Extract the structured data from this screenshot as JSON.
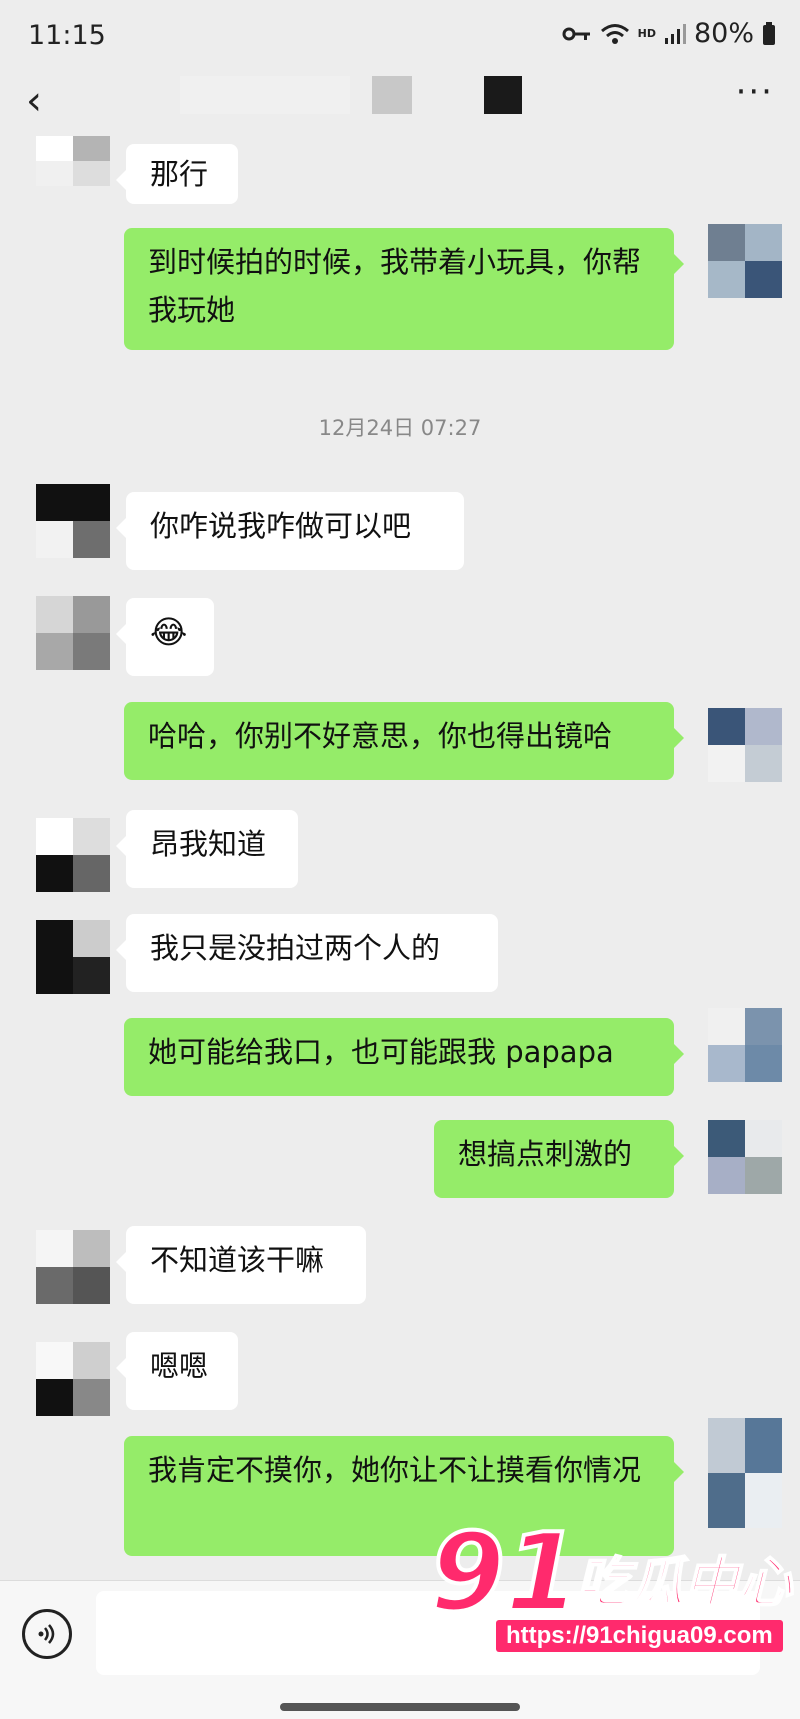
{
  "status_bar": {
    "time": "11:15",
    "battery": "80%",
    "network_label": "HD"
  },
  "header": {
    "back_icon": "‹",
    "more_icon": "···"
  },
  "timestamp": "12月24日 07:27",
  "messages": [
    {
      "side": "left",
      "text": "那行"
    },
    {
      "side": "right",
      "text": "到时候拍的时候，我带着小玩具，你帮我玩她"
    },
    {
      "side": "left",
      "text": "你咋说我咋做可以吧"
    },
    {
      "side": "left",
      "text": "😂",
      "icon": "laughing-tears-emoji"
    },
    {
      "side": "right",
      "text": "哈哈，你别不好意思，你也得出镜哈"
    },
    {
      "side": "left",
      "text": "昂我知道"
    },
    {
      "side": "left",
      "text": "我只是没拍过两个人的"
    },
    {
      "side": "right",
      "text": "她可能给我口，也可能跟我 papapa"
    },
    {
      "side": "right",
      "text": "想搞点刺激的"
    },
    {
      "side": "left",
      "text": "不知道该干嘛"
    },
    {
      "side": "left",
      "text": "嗯嗯"
    },
    {
      "side": "right",
      "text": "我肯定不摸你，她你让不让摸看你情况"
    }
  ],
  "watermark": {
    "number": "91",
    "name": "吃瓜中心",
    "url": "https://91chigua09.com"
  },
  "colors": {
    "sent_bubble": "#95ec69",
    "received_bubble": "#ffffff",
    "background": "#ededed",
    "watermark": "#ff2a6d"
  }
}
